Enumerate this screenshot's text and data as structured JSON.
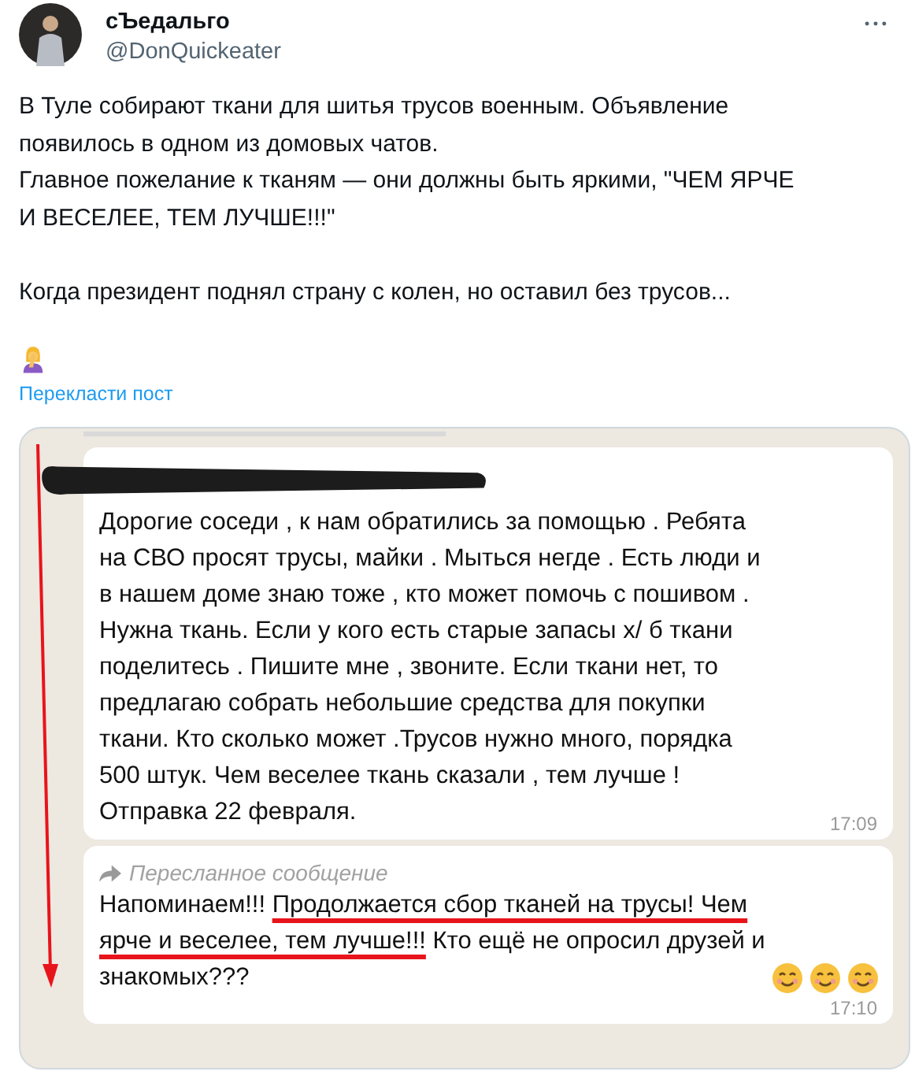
{
  "author": {
    "name": "сЪедальго",
    "handle": "@DonQuickeater"
  },
  "tweet_text": "В Туле собирают ткани для шитья трусов военным. Объявление\nпоявилось в одном из домовых чатов.\nГлавное пожелание к тканям — они должны быть яркими, \"ЧЕМ ЯРЧЕ\nИ ВЕСЕЛЕЕ, ТЕМ ЛУЧШЕ!!!\"\n\nКогда президент поднял страну с колен, но оставил без трусов...",
  "translate_link": "Перекласти пост",
  "messages": [
    {
      "kind": "message",
      "text": "Дорогие соседи , к нам обратились за помощью . Ребята\nна СВО просят трусы, майки . Мыться негде . Есть люди и\nв нашем доме знаю тоже , кто может помочь с пошивом .\nНужна ткань. Если у кого есть старые запасы х/ б ткани\nподелитесь . Пишите мне , звоните. Если ткани нет, то\nпредлагаю собрать небольшие средства для покупки\nткани. Кто сколько может .Трусов нужно много, порядка\n500 штук. Чем веселее ткань сказали , тем лучше !\nОтправка 22 февраля.",
      "time": "17:09"
    },
    {
      "kind": "forwarded",
      "forward_label": "Пересланное сообщение",
      "segments": [
        {
          "text": "Напоминаем!!! ",
          "underlined": false
        },
        {
          "text": "Продолжается сбор тканей на трусы! Чем\nярче и веселее, тем лучше!!!",
          "underlined": true
        },
        {
          "text": " Кто ещё не опросил друзей и\nзнакомых???",
          "underlined": false
        }
      ],
      "emoji": [
        {
          "kind": "smile"
        },
        {
          "kind": "smile"
        },
        {
          "kind": "smile"
        }
      ],
      "time": "17:10"
    }
  ]
}
